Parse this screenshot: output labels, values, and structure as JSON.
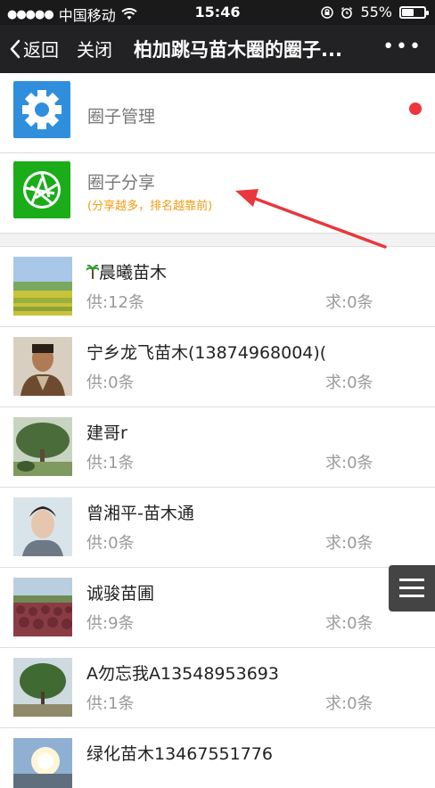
{
  "status_bar": {
    "carrier": "中国移动",
    "time": "15:46",
    "battery": "55%",
    "battery_level": 0.55
  },
  "navbar": {
    "back_label": "返回",
    "close_label": "关闭",
    "title": "柏加跳马苗木圈的圈子...",
    "more_label": "•••"
  },
  "menu": {
    "manage_label": "圈子管理",
    "share_label": "圈子分享",
    "share_hint": "(分享越多，排名越靠前)"
  },
  "members": [
    {
      "name": "晨曦苗木",
      "supply": "供:12条",
      "demand": "求:0条"
    },
    {
      "name": "宁乡龙飞苗木(13874968004)(",
      "supply": "供:0条",
      "demand": "求:0条"
    },
    {
      "name": "建哥r",
      "supply": "供:1条",
      "demand": "求:0条"
    },
    {
      "name": "曾湘平-苗木通",
      "supply": "供:0条",
      "demand": "求:0条"
    },
    {
      "name": "诚骏苗圃",
      "supply": "供:9条",
      "demand": "求:0条"
    },
    {
      "name": "A勿忘我A13548953693",
      "supply": "供:1条",
      "demand": "求:0条"
    },
    {
      "name": "绿化苗木13467551776",
      "supply": "",
      "demand": ""
    }
  ],
  "colors": {
    "manage_tile": "#2f8fdc",
    "share_tile": "#1aac19",
    "accent_orange": "#f39c12",
    "red_dot": "#f0353d",
    "arrow": "#e8383d"
  }
}
